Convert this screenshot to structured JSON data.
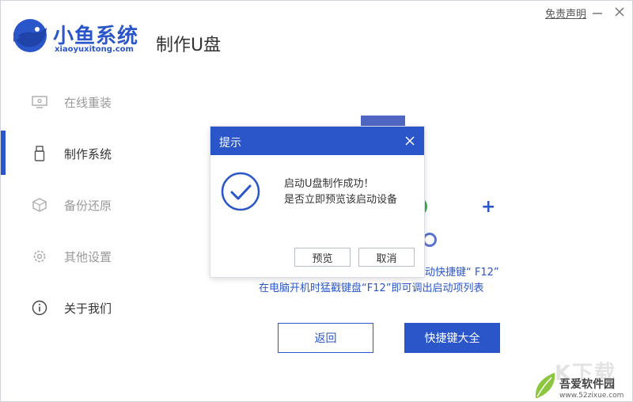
{
  "brand": {
    "name_cn": "小鱼系统",
    "name_en": "xiaoyuxitong.com",
    "accent_color": "#2b56c9"
  },
  "header": {
    "title": "制作U盘",
    "disclaimer": "免责声明",
    "minimize_icon": "minimize-icon",
    "close_icon": "close-icon"
  },
  "sidebar": {
    "items": [
      {
        "label": "在线重装",
        "icon": "monitor-icon",
        "active": false
      },
      {
        "label": "制作系统",
        "icon": "usb-icon",
        "active": true
      },
      {
        "label": "备份还原",
        "icon": "cube-icon",
        "active": false
      },
      {
        "label": "其他设置",
        "icon": "gear-icon",
        "active": false
      },
      {
        "label": "关于我们",
        "icon": "info-icon",
        "active": false
      }
    ]
  },
  "main": {
    "hint_line1": "动快捷键“ F12”",
    "hint_line2": "在电脑开机时猛戳键盘“F12”即可调出启动项列表",
    "back_button": "返回",
    "shortcut_button": "快捷键大全"
  },
  "dialog": {
    "title": "提示",
    "message_line1": "启动U盘制作成功！",
    "message_line2": "是否立即预览该启动设备",
    "preview_button": "预览",
    "cancel_button": "取消",
    "check_icon": "check-circle-icon"
  },
  "watermark": {
    "site_name": "吾爱软件园",
    "site_url": "www.52zixue.com"
  }
}
